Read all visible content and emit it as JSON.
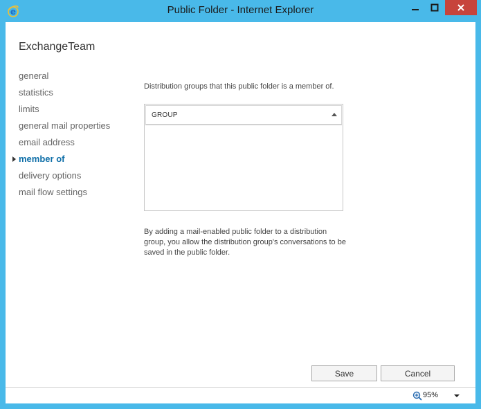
{
  "window": {
    "title": "Public Folder - Internet Explorer"
  },
  "app": {
    "title": "ExchangeTeam"
  },
  "nav": {
    "items": [
      {
        "label": "general"
      },
      {
        "label": "statistics"
      },
      {
        "label": "limits"
      },
      {
        "label": "general mail properties"
      },
      {
        "label": "email address"
      },
      {
        "label": "member of"
      },
      {
        "label": "delivery options"
      },
      {
        "label": "mail flow settings"
      }
    ],
    "active_index": 5
  },
  "main": {
    "description": "Distribution groups that this public folder is a member of.",
    "grid": {
      "columns": [
        "GROUP"
      ],
      "rows": []
    },
    "note": "By adding a mail-enabled public folder to a distribution group, you allow the distribution group's conversations to be saved in the public folder."
  },
  "buttons": {
    "save": "Save",
    "cancel": "Cancel"
  },
  "statusbar": {
    "zoom": "95%"
  },
  "icons": {
    "app": "internet-explorer-icon",
    "minimize": "minimize-icon",
    "maximize": "maximize-icon",
    "close": "close-icon",
    "zoom": "zoom-icon",
    "sort": "sort-ascending-icon"
  },
  "colors": {
    "frame": "#49b9e9",
    "close_button": "#c7443c",
    "active_nav": "#0f6fa8"
  }
}
